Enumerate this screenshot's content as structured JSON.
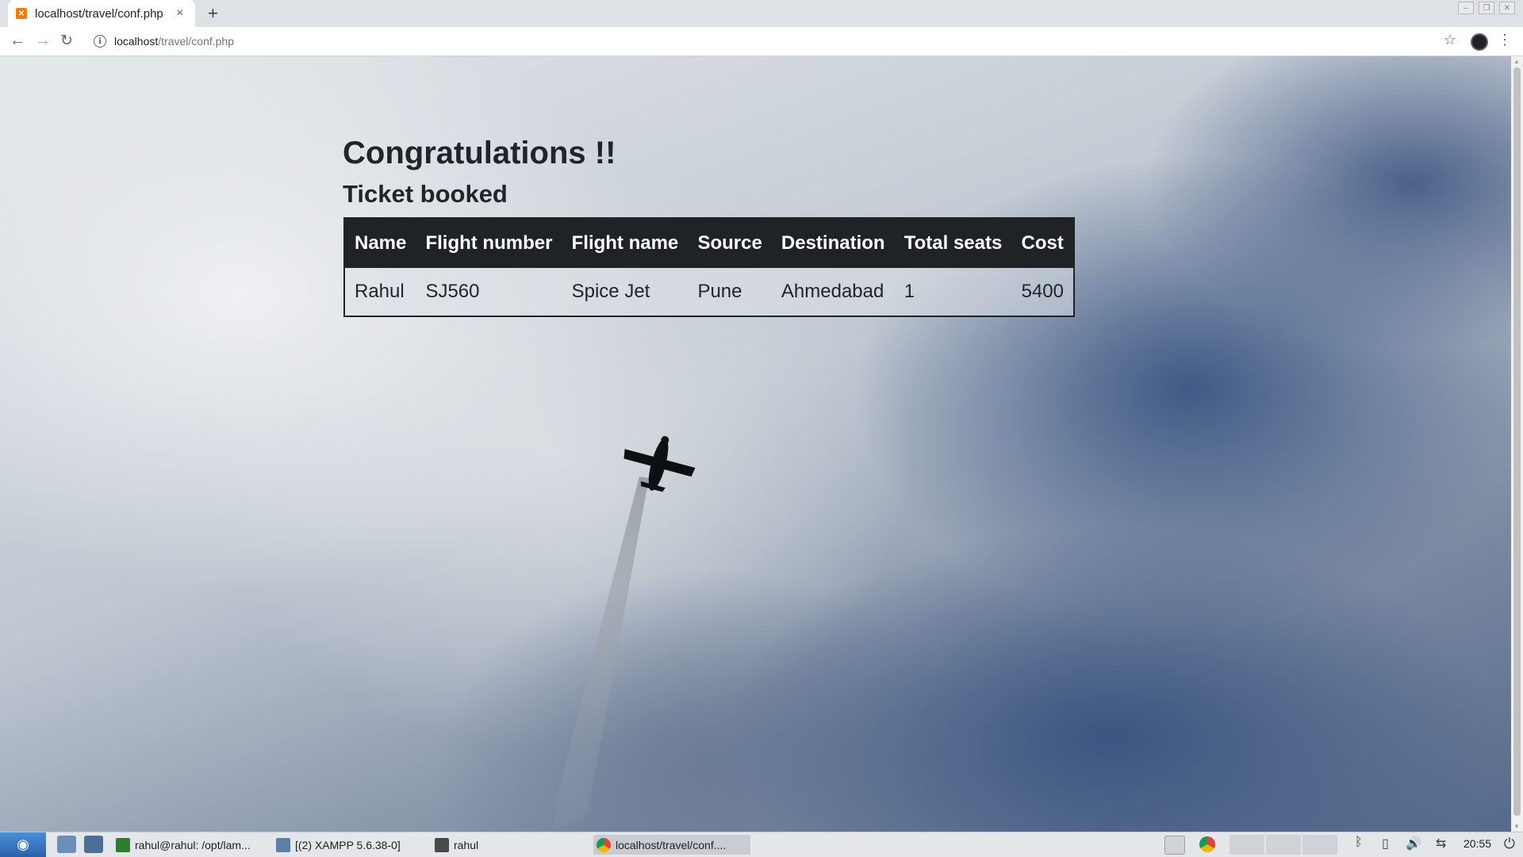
{
  "browser": {
    "tab_title": "localhost/travel/conf.php",
    "tab_favicon": "xampp-icon",
    "new_tab_label": "+",
    "close_tab_label": "×",
    "url_host": "localhost",
    "url_path": "/travel/conf.php"
  },
  "page": {
    "heading": "Congratulations !!",
    "subheading": "Ticket booked",
    "table": {
      "headers": [
        "Name",
        "Flight number",
        "Flight name",
        "Source",
        "Destination",
        "Total seats",
        "Cost"
      ],
      "rows": [
        [
          "Rahul",
          "SJ560",
          "Spice Jet",
          "Pune",
          "Ahmedabad",
          "1",
          "5400"
        ]
      ]
    }
  },
  "taskbar": {
    "items": [
      {
        "label": "rahul@rahul: /opt/lam...",
        "icon": "terminal-icon"
      },
      {
        "label": "[(2) XAMPP 5.6.38-0]",
        "icon": "window-icon"
      },
      {
        "label": "rahul",
        "icon": "folder-icon"
      },
      {
        "label": "localhost/travel/conf....",
        "icon": "chrome-icon"
      }
    ],
    "clock": "20:55"
  },
  "colors": {
    "table_header_bg": "#1f2326",
    "heading_text": "#212529",
    "taskbar_bg": "#e4e6e9",
    "favicon": "#f57c00"
  }
}
